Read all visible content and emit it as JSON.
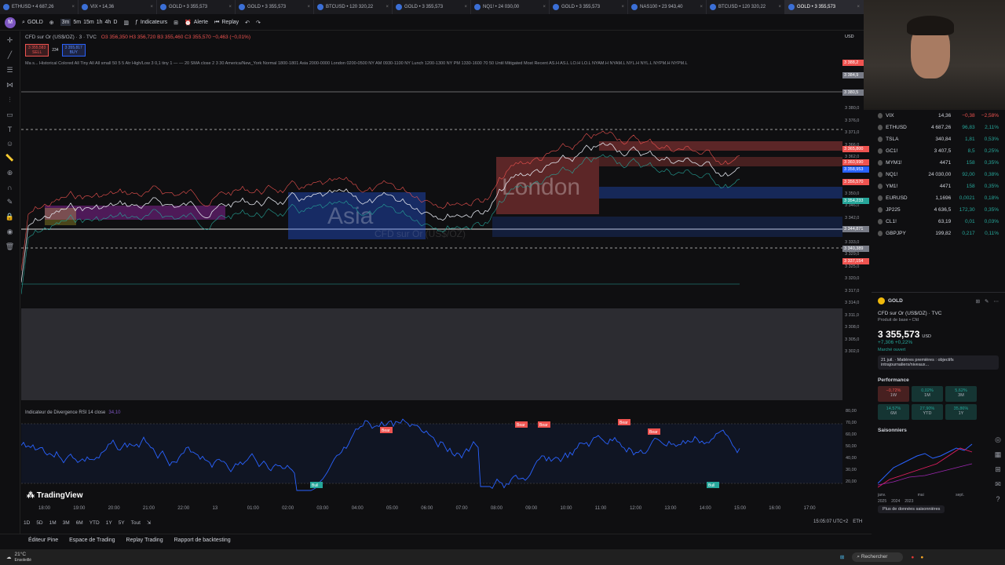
{
  "tabs": [
    {
      "label": "ETHUSD • 4 687,26",
      "active": false
    },
    {
      "label": "VIX • 14,36",
      "active": false
    },
    {
      "label": "GOLD • 3 355,573",
      "active": false
    },
    {
      "label": "GOLD • 3 355,573",
      "active": false
    },
    {
      "label": "BTCUSD • 120 320,22",
      "active": false
    },
    {
      "label": "GOLD • 3 355,573",
      "active": false
    },
    {
      "label": "NQ1! • 24 030,00",
      "active": false
    },
    {
      "label": "GOLD • 3 355,573",
      "active": false
    },
    {
      "label": "NAS100 • 23 943,40",
      "active": false
    },
    {
      "label": "BTCUSD • 120 320,22",
      "active": false
    },
    {
      "label": "GOLD • 3 355,573",
      "active": true
    }
  ],
  "toolbar": {
    "avatar": "M",
    "symbol": "GOLD",
    "intervals": [
      "3m",
      "5m",
      "15m",
      "1h",
      "4h",
      "D"
    ],
    "indicators": "Indicateurs",
    "alert": "Alerte",
    "replay": "Replay"
  },
  "legend": {
    "title": "CFD sur Or (US$/OZ) · 3 · TVC",
    "ohlc": "O3 356,350 H3 356,720 B3 355,460 C3 355,570 −0,463 (−0,01%)",
    "sell_price": "3 355,583",
    "sell_label": "SELL",
    "spread": "234",
    "buy_price": "3 355,817",
    "buy_label": "BUY",
    "indicator_line": "Ma s... Historical Colored All Tiny All All small 50 5 5 Atr High/Low 3 0,1 tiny 1 — — 20 SMA close 2 3 30 America/New_York Normal 1800-1801 Asia 2000-0000 London 0200-0500 NY AM 0930-1100 NY Lunch 1200-1300 NY PM 1330-1600 70 50 Until Mitigated Most Recent AS.H AS.L LO.H LO.L NYAM.H NYAM.L NYL.H NYL.L NYPM.H NYPM.L"
  },
  "sessions": {
    "london": "London",
    "asia": "Asia",
    "watermark": "CFD sur Or (US$/OZ)"
  },
  "pricescale": {
    "currency": "USD",
    "labels": [
      "3 380,0",
      "3 376,0",
      "3 371,0",
      "3 366,0",
      "3 362,0",
      "3 358,0",
      "3 354,0",
      "3 350,0",
      "3 346,0",
      "3 342,0",
      "3 338,0",
      "3 333,0",
      "3 329,0",
      "3 325,0",
      "3 320,0",
      "3 317,0",
      "3 314,0",
      "3 311,0",
      "3 308,0",
      "3 305,0",
      "3 302,0"
    ],
    "boxes": [
      {
        "v": "3 388,2",
        "c": "#ef5350"
      },
      {
        "v": "3 384,9",
        "c": "#787b86"
      },
      {
        "v": "3 380,5",
        "c": "#787b86"
      },
      {
        "v": "3 365,800",
        "c": "#ef5350"
      },
      {
        "v": "3 360,990",
        "c": "#ef5350"
      },
      {
        "v": "3 358,953",
        "c": "#2962ff"
      },
      {
        "v": "3 356,570",
        "c": "#ef5350"
      },
      {
        "v": "3 354,233",
        "c": "#26a69a"
      },
      {
        "v": "3 344,871",
        "c": "#787b86"
      },
      {
        "v": "3 340,389",
        "c": "#787b86"
      },
      {
        "v": "3 337,154",
        "c": "#ef5350"
      }
    ]
  },
  "rsi": {
    "title": "Indicateur de Divergence RSI 14 close",
    "value": "34,10",
    "scale": [
      "80,00",
      "70,00",
      "60,00",
      "50,00",
      "40,00",
      "30,00",
      "20,00"
    ],
    "bear": "Bear",
    "bull": "Bull"
  },
  "timeaxis": {
    "labels": [
      "18:00",
      "19:00",
      "20:00",
      "21:00",
      "22:00",
      "13",
      "01:00",
      "02:00",
      "03:00",
      "04:00",
      "05:00",
      "06:00",
      "07:00",
      "08:00",
      "09:00",
      "10:00",
      "11:00",
      "12:00",
      "13:00",
      "14:00",
      "15:00",
      "16:00",
      "17:00"
    ],
    "clock": "15:05:07 UTC+2",
    "session": "ETH"
  },
  "brand": "TradingView",
  "ranges": [
    "1D",
    "5D",
    "1M",
    "3M",
    "6M",
    "YTD",
    "1Y",
    "5Y",
    "Tout"
  ],
  "bottomtabs": [
    "Éditeur Pine",
    "Espace de Trading",
    "Replay Trading",
    "Rapport de backtesting"
  ],
  "watchlist": [
    {
      "sym": "VIX",
      "v": "14,36",
      "c": "−0,38",
      "p": "−2,58%",
      "col": "#ef5350"
    },
    {
      "sym": "ETHUSD",
      "v": "4 687,26",
      "c": "96,83",
      "p": "2,11%",
      "col": "#26a69a"
    },
    {
      "sym": "TSLA",
      "v": "340,84",
      "c": "1,81",
      "p": "0,53%",
      "col": "#26a69a"
    },
    {
      "sym": "GC1!",
      "v": "3 407,5",
      "c": "8,5",
      "p": "0,25%",
      "col": "#26a69a"
    },
    {
      "sym": "MYM1!",
      "v": "4471",
      "c": "158",
      "p": "0,35%",
      "col": "#26a69a"
    },
    {
      "sym": "NQ1!",
      "v": "24 030,00",
      "c": "92,00",
      "p": "0,38%",
      "col": "#26a69a"
    },
    {
      "sym": "YM1!",
      "v": "4471",
      "c": "158",
      "p": "0,35%",
      "col": "#26a69a"
    },
    {
      "sym": "EURUSD",
      "v": "1,1696",
      "c": "0,0021",
      "p": "0,18%",
      "col": "#26a69a"
    },
    {
      "sym": "JP225",
      "v": "4 636,5",
      "c": "172,30",
      "p": "0,35%",
      "col": "#26a69a"
    },
    {
      "sym": "CL1!",
      "v": "63,19",
      "c": "0,01",
      "p": "0,03%",
      "col": "#26a69a"
    },
    {
      "sym": "GBPJPY",
      "v": "199,82",
      "c": "0,217",
      "p": "0,11%",
      "col": "#26a69a"
    }
  ],
  "details": {
    "symbol": "GOLD",
    "name": "CFD sur Or (US$/OZ) · TVC",
    "sub": "Produit de base • Cfd",
    "price": "3 355,573",
    "currency": "USD",
    "change": "+7,306 +0,22%",
    "market": "Marché ouvert",
    "news": "21 juil. · Matières premières : objectifs intrajournaliers/niveaux...",
    "perf_title": "Performance",
    "perf": [
      {
        "v": "−0,72%",
        "l": "1W",
        "pos": false
      },
      {
        "v": "0,02%",
        "l": "1M",
        "pos": true
      },
      {
        "v": "5,62%",
        "l": "3M",
        "pos": true
      },
      {
        "v": "14,57%",
        "l": "6M",
        "pos": true
      },
      {
        "v": "27,90%",
        "l": "YTD",
        "pos": true
      },
      {
        "v": "35,86%",
        "l": "1Y",
        "pos": true
      }
    ],
    "seasonal_title": "Saisonniers",
    "seasonal_x": [
      "janv.",
      "mai",
      "sept."
    ],
    "seasonal_legend": [
      "2025",
      "2024",
      "2023"
    ],
    "more": "Plus de données saisonnières"
  },
  "taskbar": {
    "weather": "21°C",
    "weather_sub": "Ensoleillé",
    "search": "Rechercher"
  }
}
